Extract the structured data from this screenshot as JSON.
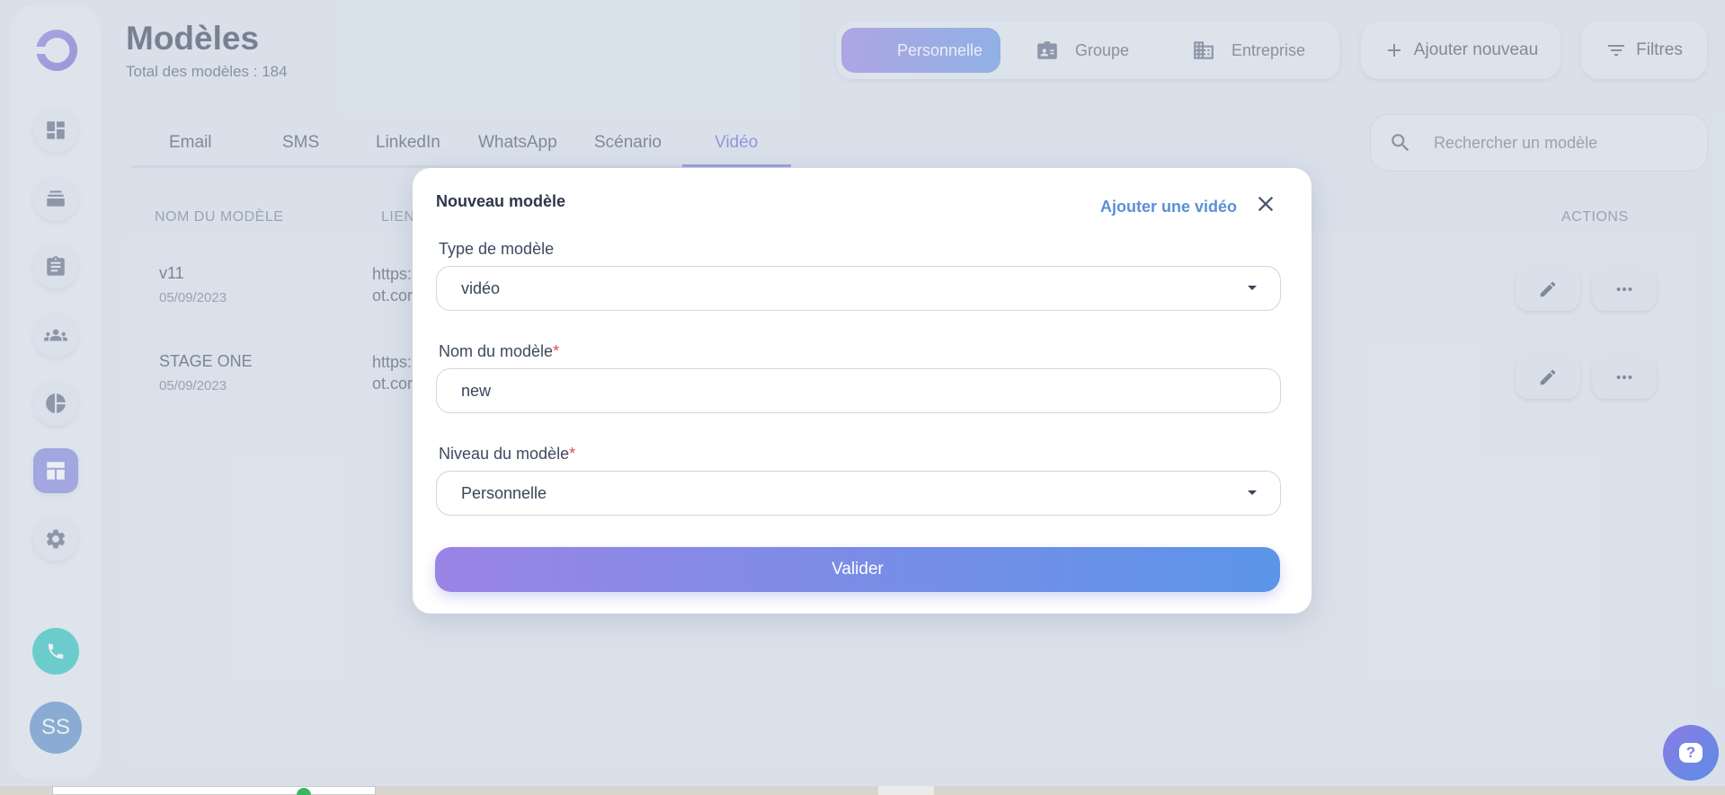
{
  "sidebar": {
    "nav": [
      "dashboard",
      "campaigns",
      "tasks",
      "contacts",
      "statistics",
      "templates",
      "settings"
    ],
    "avatar_initials": "SS"
  },
  "header": {
    "title": "Modèles",
    "subtitle": "Total des modèles : 184",
    "levels": [
      "Personnelle",
      "Groupe",
      "Entreprise"
    ],
    "add_label": "Ajouter nouveau",
    "filters_label": "Filtres"
  },
  "tabs": [
    "Email",
    "SMS",
    "LinkedIn",
    "WhatsApp",
    "Scénario",
    "Vidéo"
  ],
  "active_tab": "Vidéo",
  "search": {
    "placeholder": "Rechercher un modèle"
  },
  "table": {
    "col_name": "NOM DU MODÈLE",
    "col_link": "LIEN",
    "col_actions": "ACTIONS",
    "rows": [
      {
        "name": "v11",
        "date": "05/09/2023",
        "link_1": "https:",
        "link_2": "ot.cor"
      },
      {
        "name": "STAGE ONE",
        "date": "05/09/2023",
        "link_1": "https:",
        "link_2": "ot.cor"
      }
    ]
  },
  "modal": {
    "title": "Nouveau modèle",
    "add_video": "Ajouter une vidéo",
    "type_label": "Type de modèle",
    "type_value": "vidéo",
    "name_label": "Nom du modèle",
    "name_value": "new",
    "level_label": "Niveau du modèle",
    "level_value": "Personnelle",
    "required_mark": "*",
    "submit": "Valider"
  },
  "help": {
    "icon": "?"
  },
  "colors": {
    "accent": "#6d72d8",
    "phone": "#17c2b7",
    "avatar": "#4f86c6",
    "required": "#e24b5a"
  }
}
